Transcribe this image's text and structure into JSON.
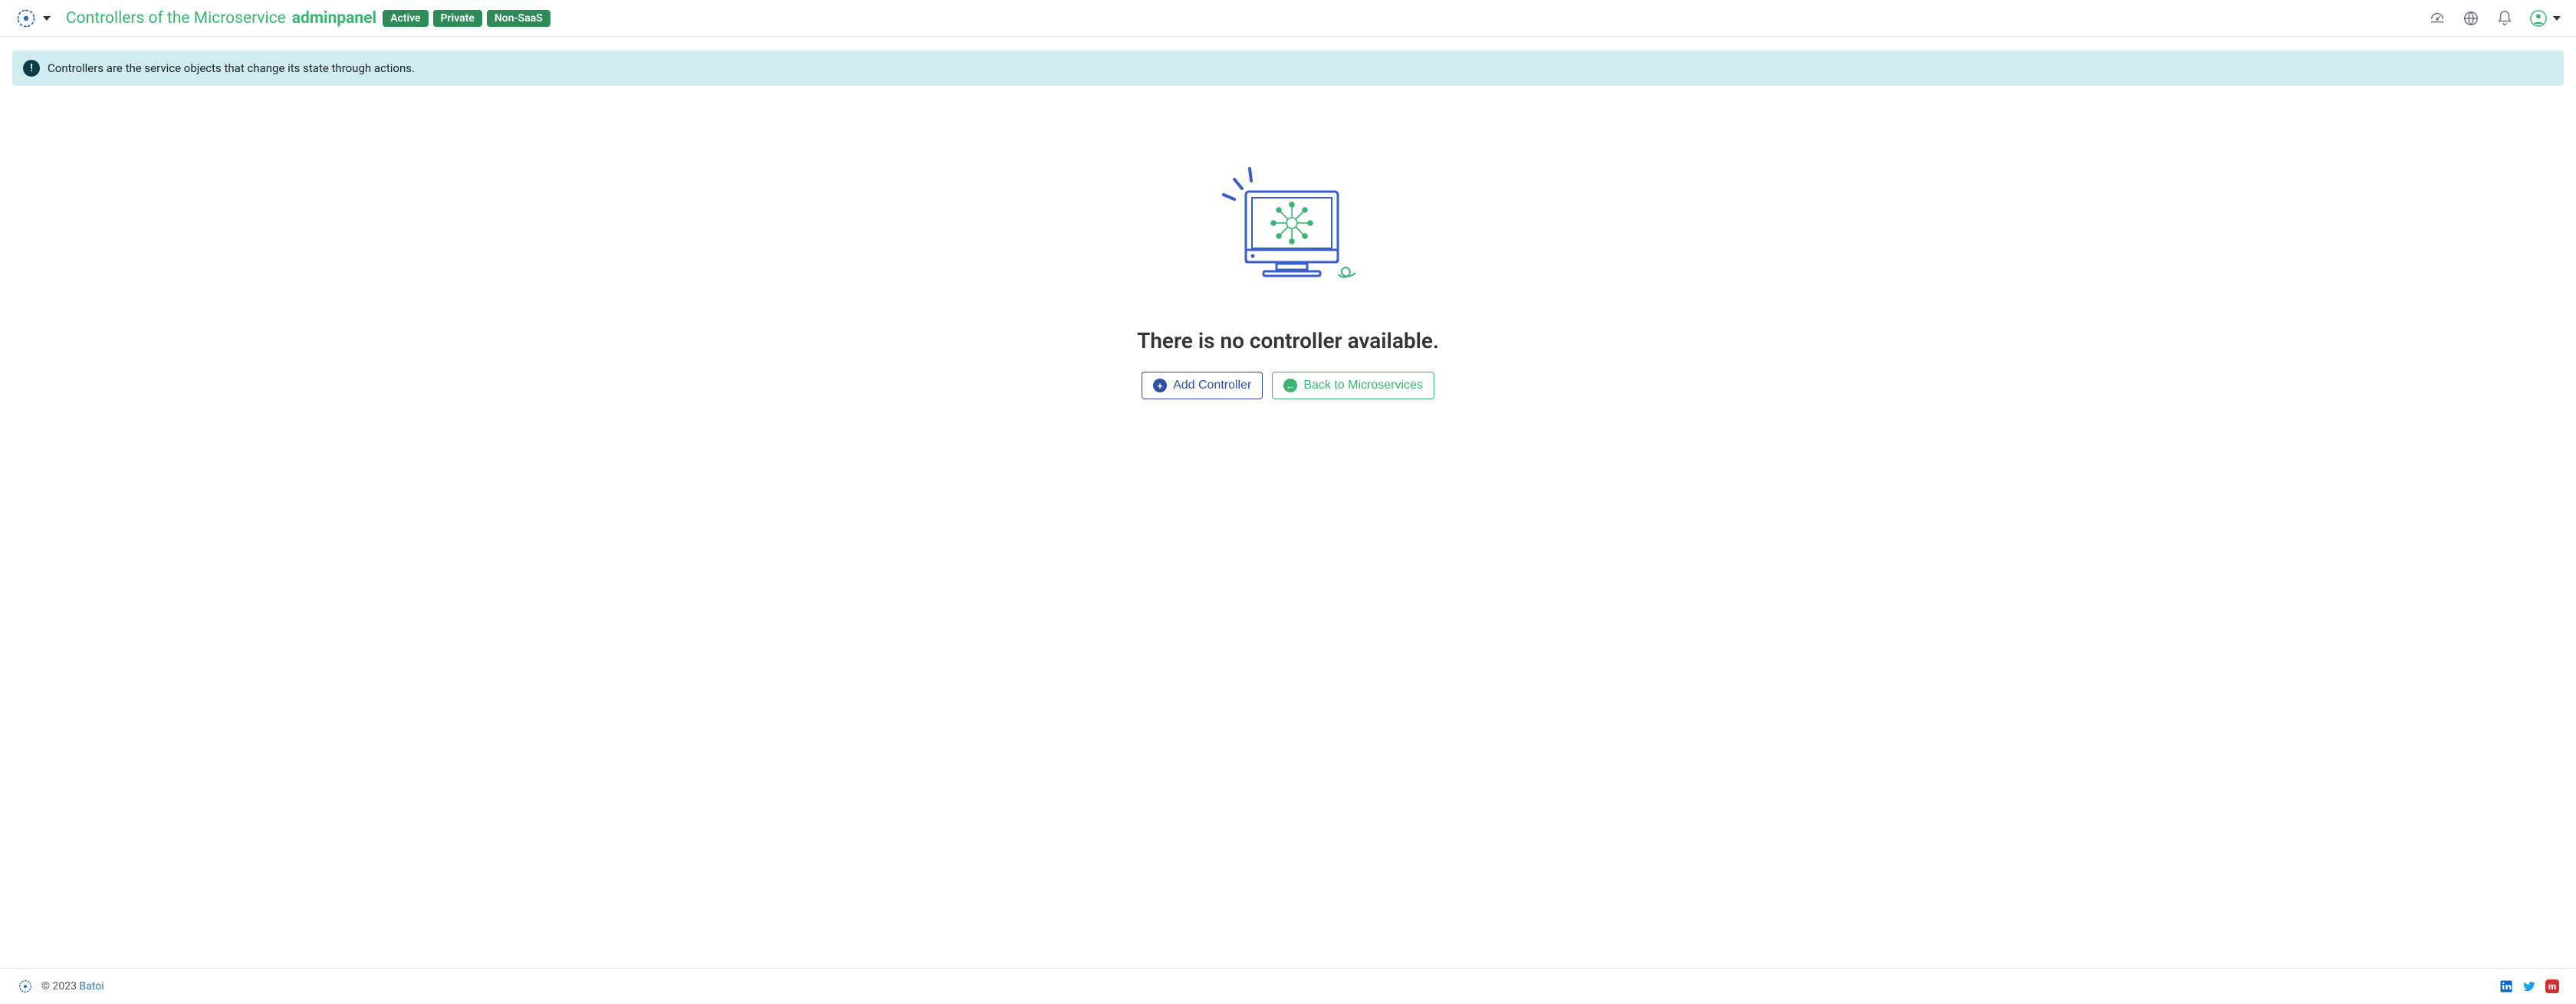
{
  "header": {
    "title_prefix": "Controllers of the Microservice",
    "service_name": "adminpanel",
    "badges": [
      "Active",
      "Private",
      "Non-SaaS"
    ]
  },
  "info_banner": {
    "text": "Controllers are the service objects that change its state through actions."
  },
  "empty_state": {
    "heading": "There is no controller available.",
    "add_button_label": "Add Controller",
    "back_button_label": "Back to Microservices"
  },
  "footer": {
    "copyright_prefix": "© 2023 ",
    "company": "Batoi"
  }
}
